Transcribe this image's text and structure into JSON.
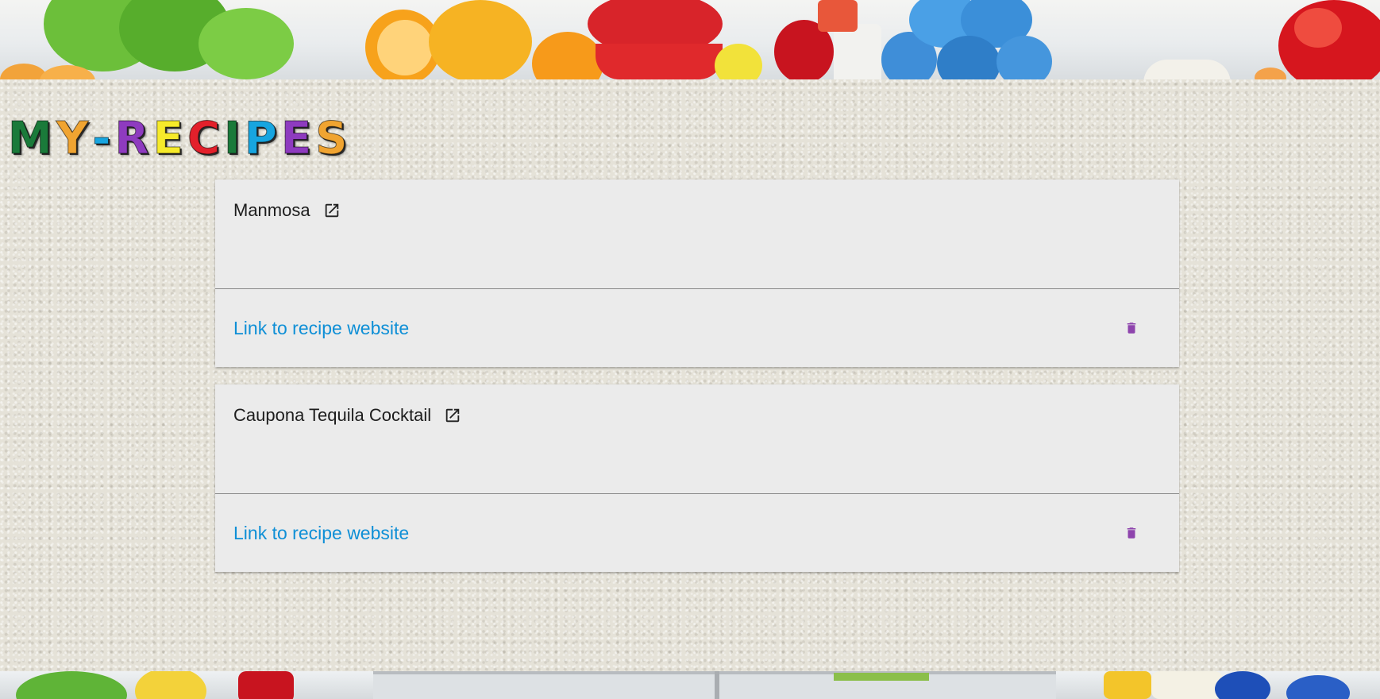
{
  "app": {
    "logo_letters": [
      {
        "char": "M",
        "color": "#1a7a3a"
      },
      {
        "char": "Y",
        "color": "#f0a431"
      },
      {
        "char": "-",
        "color": "#17a5e0"
      },
      {
        "char": "R",
        "color": "#8e3bbf"
      },
      {
        "char": "E",
        "color": "#f6ea2a"
      },
      {
        "char": "C",
        "color": "#e3202b"
      },
      {
        "char": "I",
        "color": "#1a7a3a"
      },
      {
        "char": "P",
        "color": "#17a5e0"
      },
      {
        "char": "E",
        "color": "#8e3bbf"
      },
      {
        "char": "S",
        "color": "#f0a431"
      }
    ]
  },
  "recipes": [
    {
      "title": "Manmosa",
      "link_label": "Link to recipe website",
      "external_icon": "external-link-icon",
      "delete_icon": "trash-icon"
    },
    {
      "title": "Caupona Tequila Cocktail",
      "link_label": "Link to recipe website",
      "external_icon": "external-link-icon",
      "delete_icon": "trash-icon"
    }
  ],
  "colors": {
    "link": "#0e8fd6",
    "delete_icon": "#8e44ad",
    "card_bg": "#ebebeb"
  }
}
